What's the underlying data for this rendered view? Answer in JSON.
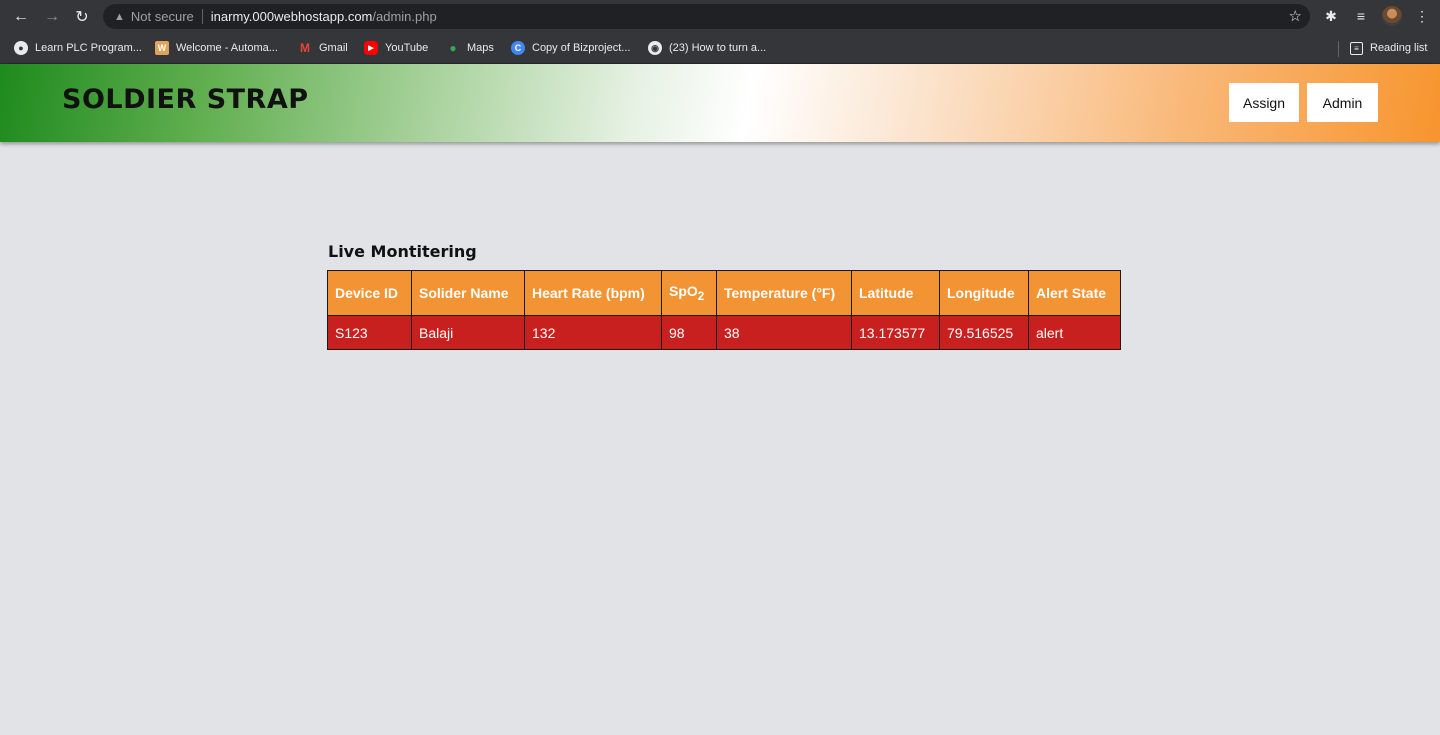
{
  "browser": {
    "security_label": "Not secure",
    "url_host": "inarmy.000webhostapp.com",
    "url_path": "/admin.php",
    "bookmarks": [
      {
        "label": "Learn PLC Program...",
        "color": "#ffffff"
      },
      {
        "label": "Welcome - Automa...",
        "color": "#e0a35a"
      },
      {
        "label": "Gmail",
        "color": "#ea4335"
      },
      {
        "label": "YouTube",
        "color": "#ff0000"
      },
      {
        "label": "Maps",
        "color": "#34a853"
      },
      {
        "label": "Copy of Bizproject...",
        "color": "#4285f4"
      },
      {
        "label": "(23) How to turn a...",
        "color": "#e8eaed"
      }
    ],
    "reading_list": "Reading list"
  },
  "header": {
    "title": "SOLDIER STRAP",
    "assign_label": "Assign",
    "admin_label": "Admin"
  },
  "main": {
    "heading": "Live Montitering",
    "columns": [
      "Device ID",
      "Solider Name",
      "Heart Rate (bpm)",
      "SpO",
      "Temperature (°F)",
      "Latitude",
      "Longitude",
      "Alert State"
    ],
    "spo_sub": "2",
    "rows": [
      [
        "S123",
        "Balaji",
        "132",
        "98",
        "38",
        "13.173577",
        "79.516525",
        "alert"
      ]
    ]
  },
  "colors": {
    "header_cell": "#f29433",
    "alert_row": "#c8201f",
    "page_bg": "#e1e3e6"
  }
}
